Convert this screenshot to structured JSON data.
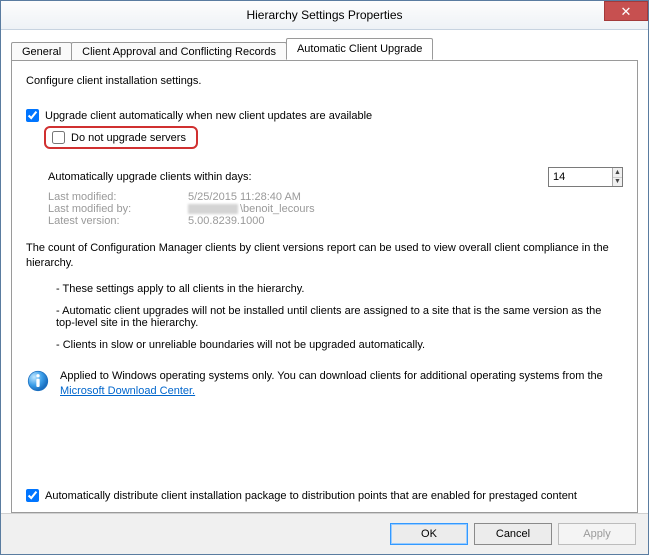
{
  "window": {
    "title": "Hierarchy Settings Properties"
  },
  "tabs": {
    "general": "General",
    "client_approval": "Client Approval and Conflicting Records",
    "auto_upgrade": "Automatic Client Upgrade"
  },
  "panel": {
    "intro": "Configure client installation settings.",
    "upgrade_check": "Upgrade client automatically when new client updates are available",
    "no_servers": "Do not upgrade servers",
    "days_label": "Automatically upgrade clients within days:",
    "days_value": "14",
    "meta": {
      "last_modified_k": "Last modified:",
      "last_modified_v": "5/25/2015 11:28:40 AM",
      "last_modified_by_k": "Last modified by:",
      "last_modified_by_v": "\\benoit_lecours",
      "latest_version_k": "Latest version:",
      "latest_version_v": "5.00.8239.1000"
    },
    "desc": "The count of Configuration Manager clients by client versions report can be used to view overall client compliance in the hierarchy.",
    "bullet1": "- These settings apply to all clients in the hierarchy.",
    "bullet2": "- Automatic client upgrades will not be installed until clients are assigned to a site that is the same version as the top-level site in the hierarchy.",
    "bullet3": "- Clients in slow or unreliable boundaries will not be upgraded automatically.",
    "info_text_pre": "Applied to Windows operating systems only. You can download clients for additional operating systems from the ",
    "info_link": "Microsoft Download Center.",
    "auto_distribute": "Automatically distribute client installation package to distribution points that are enabled for prestaged content"
  },
  "buttons": {
    "ok": "OK",
    "cancel": "Cancel",
    "apply": "Apply"
  }
}
